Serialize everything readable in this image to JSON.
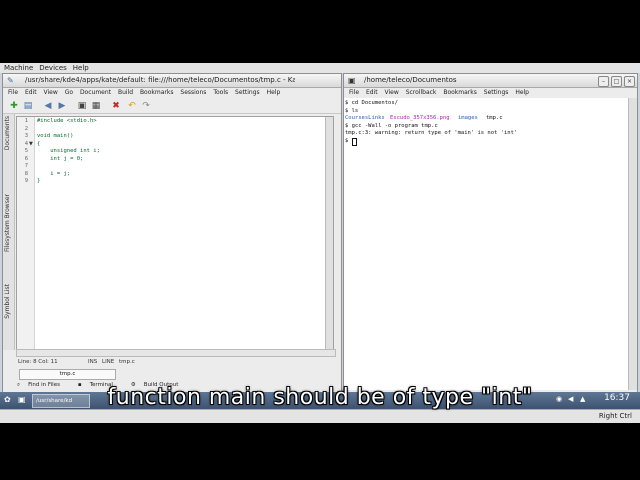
{
  "vbox_menu": [
    "Machine",
    "Devices",
    "Help"
  ],
  "kate": {
    "title": "/usr/share/kde4/apps/kate/default: file:///home/teleco/Documentos/tmp.c - Kate",
    "menu": [
      "File",
      "Edit",
      "View",
      "Go",
      "Document",
      "Build",
      "Bookmarks",
      "Sessions",
      "Tools",
      "Settings",
      "Help"
    ],
    "side_tabs": [
      "Documents",
      "Filesystem Browser",
      "Symbol List"
    ],
    "lines": [
      {
        "num": "1",
        "text": "#include <stdio.h>"
      },
      {
        "num": "2",
        "text": ""
      },
      {
        "num": "3",
        "text": "void main()"
      },
      {
        "num": "4",
        "text": "{"
      },
      {
        "num": "5",
        "text": "    unsigned int i;"
      },
      {
        "num": "6",
        "text": "    int j = 0;"
      },
      {
        "num": "7",
        "text": ""
      },
      {
        "num": "8",
        "text": "    i = j;"
      },
      {
        "num": "9",
        "text": "}"
      }
    ],
    "status": {
      "position": "Line: 8 Col: 11",
      "mode": "INS",
      "line_mode": "LINE",
      "file": "tmp.c"
    },
    "doc_tab": "tmp.c",
    "bottom_tabs": [
      "Find in Files",
      "Terminal",
      "Build Output"
    ]
  },
  "konsole": {
    "title": "/home/teleco/Documentos",
    "menu": [
      "File",
      "Edit",
      "View",
      "Scrollback",
      "Bookmarks",
      "Settings",
      "Help"
    ],
    "lines": [
      "$ cd Documentos/",
      "$ ls",
      "",
      "$ gcc -Wall -o program tmp.c",
      "tmp.c:3: warning: return type of 'main' is not 'int'",
      "$ "
    ],
    "ls_output": [
      {
        "text": "CoursesLinks",
        "color": "#2a5db0"
      },
      {
        "text": "Escudo_357x356.png",
        "color": "#b020b0"
      },
      {
        "text": "images",
        "color": "#2a5db0"
      },
      {
        "text": "tmp.c",
        "color": "#111111"
      }
    ]
  },
  "taskbar": {
    "task": "/usr/share/kd",
    "clock": "16:37"
  },
  "vbox_status": "Right Ctrl",
  "caption": "function main should be of type \"int\""
}
